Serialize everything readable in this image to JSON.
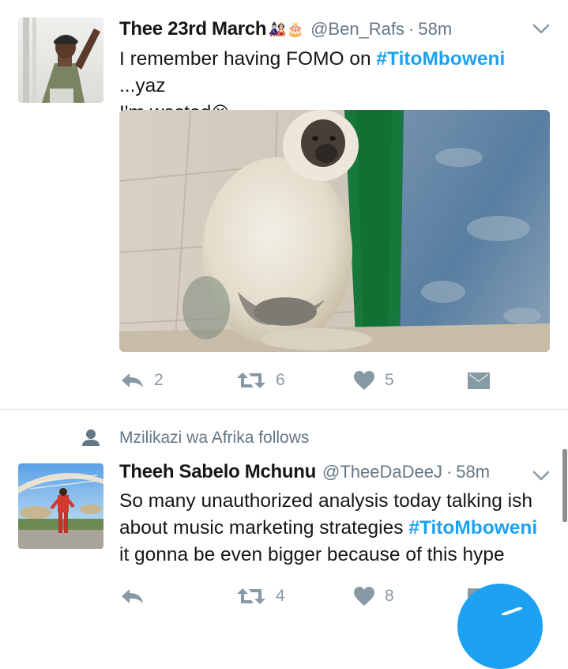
{
  "tweets": [
    {
      "display_name": "Thee 23rd March",
      "name_emojis": "🎎🎂",
      "handle": "@Ben_Rafs",
      "separator": "·",
      "time": "58m",
      "text_line1_pre": "I remember having FOMO on ",
      "text_line1_hashtag": "#TitoMboweni",
      "text_line1_post": " ...yaz",
      "text_line2": "I'm wasted",
      "text_emoji": "😣",
      "media_description_icon": "photo-monkey",
      "reply_count": "2",
      "retweet_count": "6",
      "like_count": "5"
    },
    {
      "social_context": "Mzilikazi wa Afrika follows",
      "display_name": "Theeh Sabelo Mchunu",
      "handle": "@TheeDaDeeJ",
      "separator": "·",
      "time": "58m",
      "text_line1": "So many unauthorized analysis today talking ish",
      "text_line2_pre": "about music marketing strategies ",
      "text_line2_hashtag": "#TitoMboweni",
      "text_line3": "it gonna be even bigger because of this hype",
      "reply_count": "",
      "retweet_count": "4",
      "like_count": "8"
    }
  ],
  "colors": {
    "accent": "#1da1f2",
    "secondary_text": "#657786",
    "action_icon": "#8899a6",
    "divider": "#d8dee3"
  }
}
